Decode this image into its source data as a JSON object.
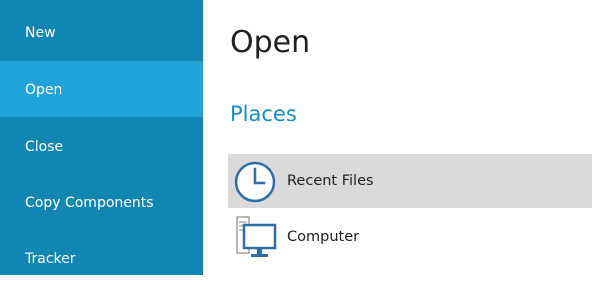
{
  "sidebar": {
    "items": [
      {
        "label": "New",
        "active": false
      },
      {
        "label": "Open",
        "active": true
      },
      {
        "label": "Close",
        "active": false
      },
      {
        "label": "Copy Components",
        "active": false
      },
      {
        "label": "Tracker",
        "active": false
      }
    ]
  },
  "main": {
    "title": "Open",
    "section_title": "Places",
    "places": [
      {
        "label": "Recent Files",
        "icon": "clock-icon",
        "selected": true
      },
      {
        "label": "Computer",
        "icon": "computer-icon",
        "selected": false
      }
    ]
  },
  "colors": {
    "sidebar_bg": "#1186b3",
    "sidebar_active": "#20a3d9",
    "section_title": "#1a8dc0",
    "selected_bg": "#dadada"
  }
}
